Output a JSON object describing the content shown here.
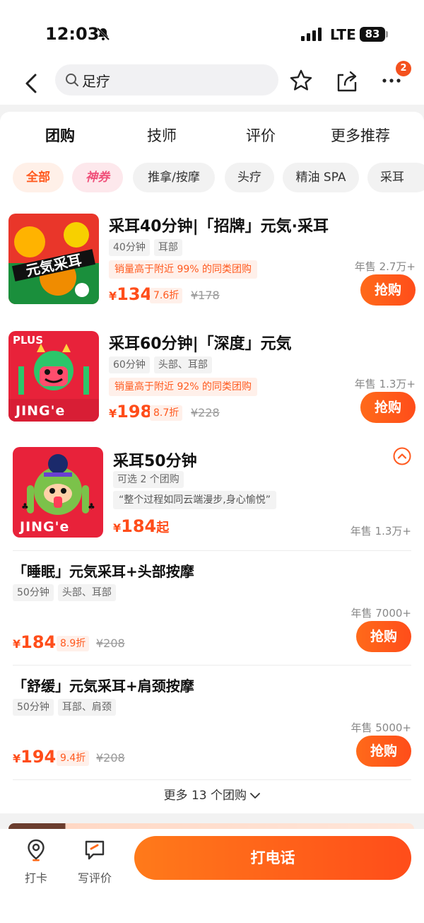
{
  "status": {
    "time": "12:03",
    "network": "LTE",
    "battery": "83"
  },
  "nav": {
    "search_value": "足疗",
    "badge": "2"
  },
  "tabs": [
    {
      "label": "团购",
      "active": true
    },
    {
      "label": "技师"
    },
    {
      "label": "评价"
    },
    {
      "label": "更多推荐"
    }
  ],
  "chips": [
    "全部",
    "神券",
    "推拿/按摩",
    "头疗",
    "精油 SPA",
    "采耳"
  ],
  "deals": [
    {
      "title": "采耳40分钟|「招牌」元気·采耳",
      "tags": [
        "40分钟",
        "耳部"
      ],
      "hot": "销量高于附近 99% 的同类团购",
      "yen": "¥",
      "price": "134",
      "discount": "7.6折",
      "original": "¥178",
      "sales": "年售 2.7万+",
      "buy": "抢购"
    },
    {
      "title": "采耳60分钟|「深度」元気",
      "tags": [
        "60分钟",
        "头部、耳部"
      ],
      "hot": "销量高于附近 92% 的同类团购",
      "yen": "¥",
      "price": "198",
      "discount": "8.7折",
      "original": "¥228",
      "sales": "年售 1.3万+",
      "buy": "抢购",
      "thumb_text_top": "PLUS",
      "thumb_text_bottom": "JING'e"
    }
  ],
  "group": {
    "title": "采耳50分钟",
    "tag": "可选 2 个团购",
    "quote": "“整个过程如同云端漫步,身心愉悦”",
    "yen": "¥",
    "price": "184",
    "suffix": "起",
    "sales": "年售 1.3万+",
    "thumb_text": "JING'e",
    "subs": [
      {
        "title": "「睡眠」元気采耳+头部按摩",
        "tags": [
          "50分钟",
          "头部、耳部"
        ],
        "yen": "¥",
        "price": "184",
        "discount": "8.9折",
        "original": "¥208",
        "sales": "年售 7000+",
        "buy": "抢购"
      },
      {
        "title": "「舒缓」元気采耳+肩颈按摩",
        "tags": [
          "50分钟",
          "耳部、肩颈"
        ],
        "yen": "¥",
        "price": "194",
        "discount": "9.4折",
        "original": "¥208",
        "sales": "年售 5000+",
        "buy": "抢购"
      }
    ],
    "more": "更多 13 个团购"
  },
  "bottom": {
    "checkin": "打卡",
    "review": "写评价",
    "call": "打电话"
  },
  "colors": {
    "accent": "#ff4d1a",
    "accent_light": "#fff0ea"
  }
}
